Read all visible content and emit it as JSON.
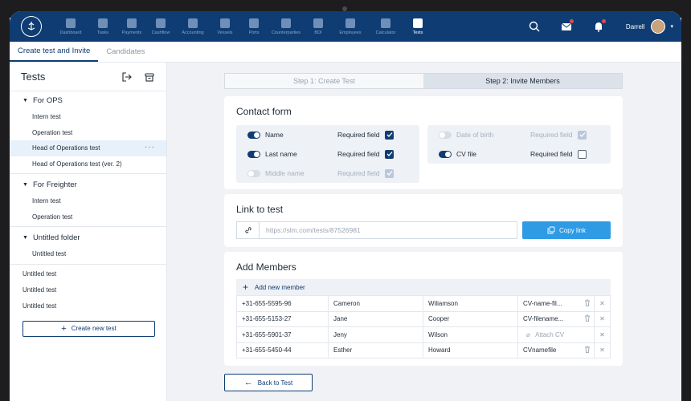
{
  "nav": {
    "items": [
      {
        "label": "Dashboard"
      },
      {
        "label": "Tasks"
      },
      {
        "label": "Payments"
      },
      {
        "label": "Cashflow"
      },
      {
        "label": "Accounting"
      },
      {
        "label": "Vessels"
      },
      {
        "label": "Ports"
      },
      {
        "label": "Counterparties"
      },
      {
        "label": "BDI"
      },
      {
        "label": "Employees"
      },
      {
        "label": "Calculator"
      },
      {
        "label": "Tests"
      }
    ],
    "user": "Darrell"
  },
  "tabs": [
    "Create test and Invite",
    "Candidates"
  ],
  "sidebar": {
    "title": "Tests",
    "folders": [
      {
        "name": "For OPS",
        "items": [
          "Intern test",
          "Operation test",
          "Head of Operations test",
          "Head of Operations test (ver. 2)"
        ]
      },
      {
        "name": "For Freighter",
        "items": [
          "Intern test",
          "Operation test"
        ]
      },
      {
        "name": "Untitled folder",
        "items": [
          "Untitled test"
        ]
      }
    ],
    "loose": [
      "Untitled test",
      "Untitled test",
      "Untitled test"
    ],
    "new_button": "Create new test"
  },
  "steps": {
    "step1": "Step 1: Create Test",
    "step2": "Step 2: Invite Members"
  },
  "contact_form": {
    "title": "Contact form",
    "required_label": "Required field",
    "fields_left": [
      "Name",
      "Last name",
      "Middle name"
    ],
    "fields_right": [
      "Date of birth",
      "CV file"
    ]
  },
  "link": {
    "title": "Link to test",
    "url": "https://slm.com/tests/87526981",
    "copy_label": "Copy link"
  },
  "members": {
    "title": "Add Members",
    "add_label": "Add new member",
    "rows": [
      {
        "phone": "+31-655-5595-96",
        "first": "Cameron",
        "last": "Wiliamson",
        "cv": "CV-name-fil..."
      },
      {
        "phone": "+31-655-5153-27",
        "first": "Jane",
        "last": "Cooper",
        "cv": "CV-filename..."
      },
      {
        "phone": "+31-655-5901-37",
        "first": "Jeny",
        "last": "Wilson",
        "cv": "Attach CV"
      },
      {
        "phone": "+31-655-5450-44",
        "first": "Esther",
        "last": "Howard",
        "cv": "CVnamefile"
      }
    ]
  },
  "back_label": "Back to Test"
}
